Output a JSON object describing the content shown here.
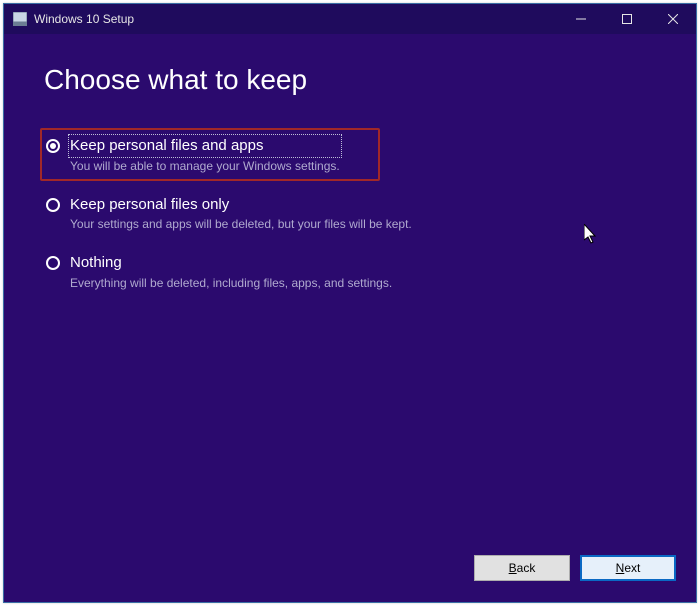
{
  "window": {
    "title": "Windows 10 Setup"
  },
  "heading": "Choose what to keep",
  "options": [
    {
      "label": "Keep personal files and apps",
      "description": "You will be able to manage your Windows settings.",
      "selected": true
    },
    {
      "label": "Keep personal files only",
      "description": "Your settings and apps will be deleted, but your files will be kept.",
      "selected": false
    },
    {
      "label": "Nothing",
      "description": "Everything will be deleted, including files, apps, and settings.",
      "selected": false
    }
  ],
  "buttons": {
    "back_prefix": "B",
    "back_rest": "ack",
    "next_prefix": "N",
    "next_rest": "ext"
  }
}
